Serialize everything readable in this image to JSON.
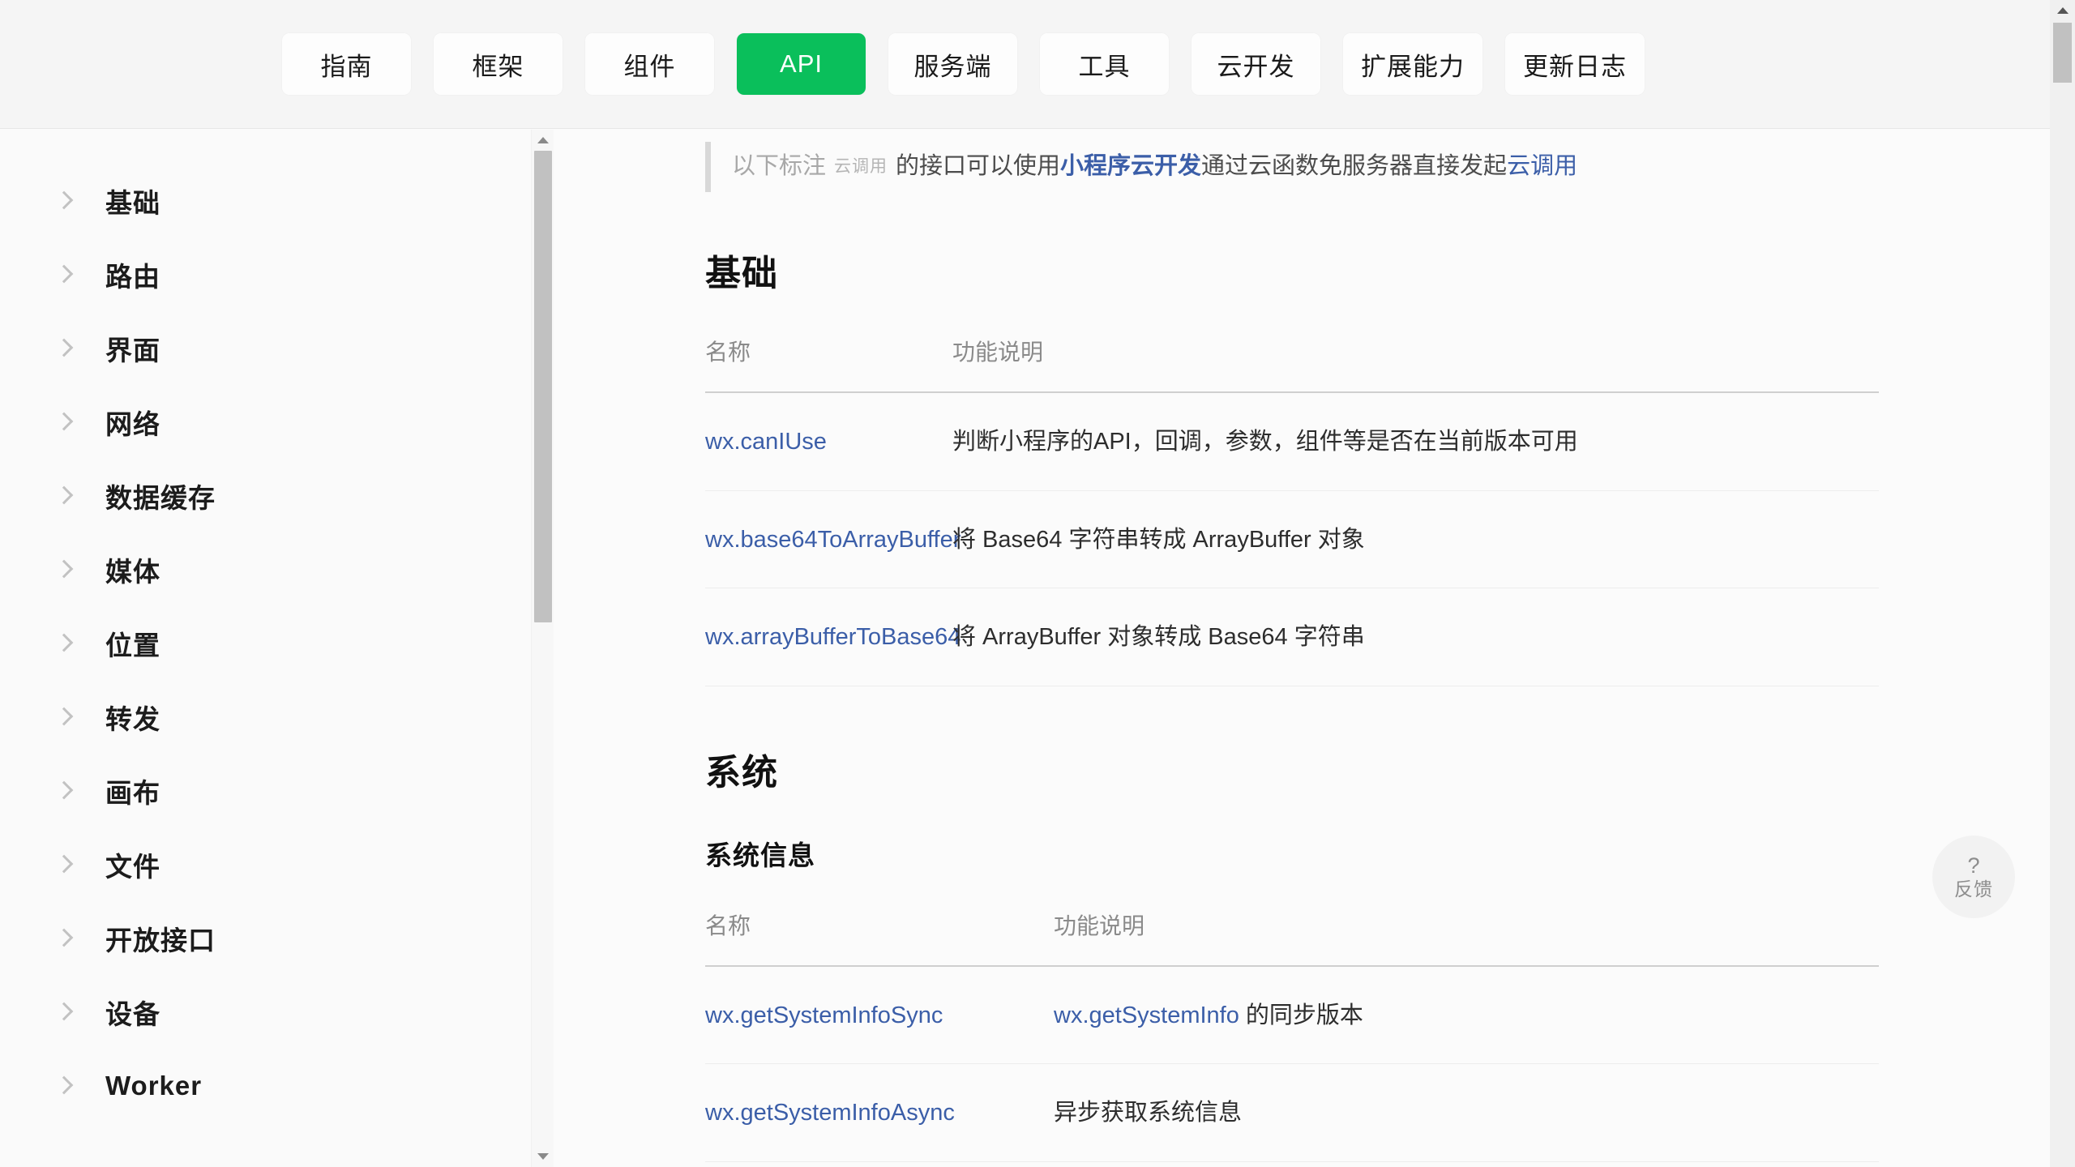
{
  "topnav": {
    "tabs": [
      {
        "label": "指南",
        "active": false
      },
      {
        "label": "框架",
        "active": false
      },
      {
        "label": "组件",
        "active": false
      },
      {
        "label": "API",
        "active": true
      },
      {
        "label": "服务端",
        "active": false
      },
      {
        "label": "工具",
        "active": false
      },
      {
        "label": "云开发",
        "active": false
      },
      {
        "label": "扩展能力",
        "active": false
      },
      {
        "label": "更新日志",
        "active": false
      }
    ],
    "active_color": "#0ABF5B",
    "active_text_color": "#FFFFFF"
  },
  "sidebar": {
    "items": [
      {
        "label": "基础",
        "icon": "chevron-right-icon"
      },
      {
        "label": "路由",
        "icon": "chevron-right-icon"
      },
      {
        "label": "界面",
        "icon": "chevron-right-icon"
      },
      {
        "label": "网络",
        "icon": "chevron-right-icon"
      },
      {
        "label": "数据缓存",
        "icon": "chevron-right-icon"
      },
      {
        "label": "媒体",
        "icon": "chevron-right-icon"
      },
      {
        "label": "位置",
        "icon": "chevron-right-icon"
      },
      {
        "label": "转发",
        "icon": "chevron-right-icon"
      },
      {
        "label": "画布",
        "icon": "chevron-right-icon"
      },
      {
        "label": "文件",
        "icon": "chevron-right-icon"
      },
      {
        "label": "开放接口",
        "icon": "chevron-right-icon"
      },
      {
        "label": "设备",
        "icon": "chevron-right-icon"
      },
      {
        "label": "Worker",
        "icon": "chevron-right-icon"
      }
    ]
  },
  "notice": {
    "prefix": "以下标注",
    "badge": "云调用",
    "middle": "的接口可以使用",
    "link1": "小程序云开发",
    "middle2": "通过云函数免服务器直接发起",
    "link2": "云调用",
    "link_color": "#3B5EA8"
  },
  "sections": [
    {
      "title": "基础",
      "table": {
        "headers": [
          "名称",
          "功能说明"
        ],
        "rows": [
          {
            "name": "wx.canIUse",
            "desc": "判断小程序的API，回调，参数，组件等是否在当前版本可用"
          },
          {
            "name": "wx.base64ToArrayBuffer",
            "desc": "将 Base64 字符串转成 ArrayBuffer 对象"
          },
          {
            "name": "wx.arrayBufferToBase64",
            "desc": "将 ArrayBuffer 对象转成 Base64 字符串"
          }
        ]
      }
    },
    {
      "title": "系统",
      "subtitle": "系统信息",
      "table": {
        "headers": [
          "名称",
          "功能说明"
        ],
        "rows": [
          {
            "name": "wx.getSystemInfoSync",
            "desc_link": "wx.getSystemInfo",
            "desc": " 的同步版本"
          },
          {
            "name": "wx.getSystemInfoAsync",
            "desc": "异步获取系统信息"
          }
        ]
      }
    }
  ],
  "feedback": {
    "icon": "question-mark-icon",
    "label": "反馈"
  },
  "scrollbars": {
    "sidebar_thumb_visible": true,
    "page_thumb_visible": true
  }
}
